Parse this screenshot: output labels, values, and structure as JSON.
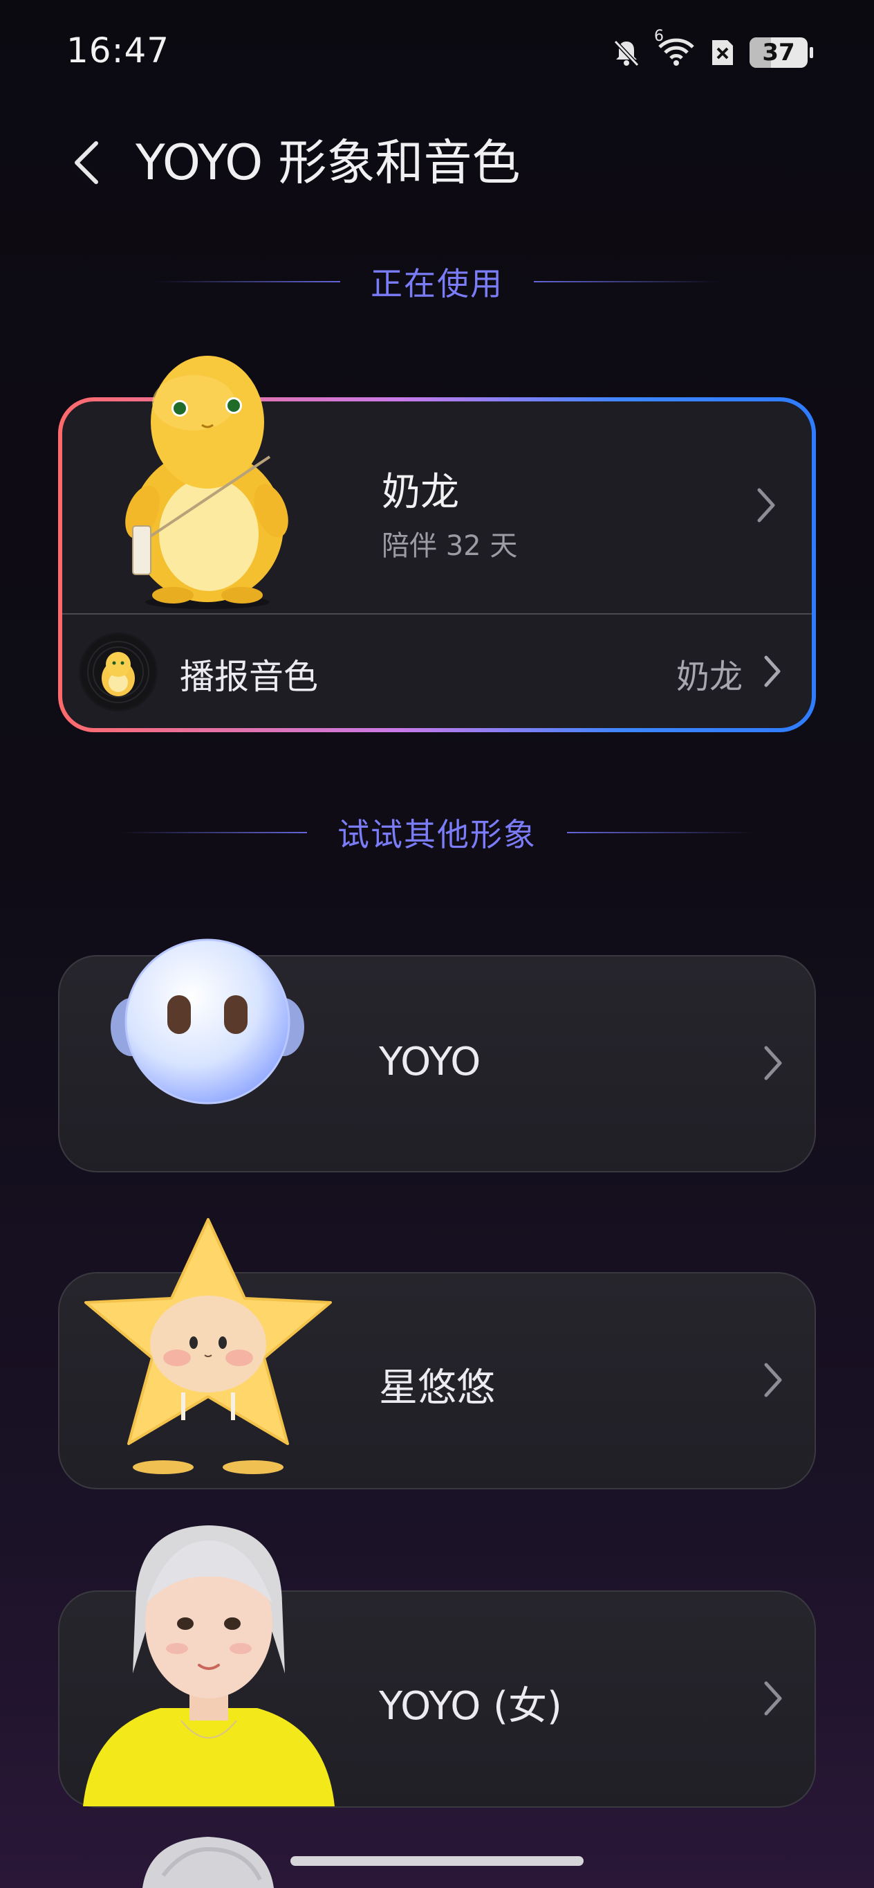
{
  "status_bar": {
    "time": "16:47",
    "battery": "37",
    "battery_level_percent": 37,
    "signal_badge": "6",
    "icons": [
      "bell-muted-icon",
      "wifi-icon",
      "sim-x-icon",
      "battery-icon"
    ]
  },
  "header": {
    "title": "YOYO 形象和音色"
  },
  "current_section": {
    "heading": "正在使用",
    "character": {
      "name": "奶龙",
      "companion_days": "陪伴 32 天"
    },
    "voice": {
      "label": "播报音色",
      "value": "奶龙"
    }
  },
  "other_section": {
    "heading": "试试其他形象",
    "items": [
      {
        "name": "YOYO"
      },
      {
        "name": "星悠悠"
      },
      {
        "name": "YOYO (女)"
      }
    ]
  },
  "colors": {
    "accent": "#7b7cf7",
    "border_gradient": [
      "#ff6a6a",
      "#c97ae8",
      "#2f7cff"
    ],
    "background": "#0c0a11"
  }
}
